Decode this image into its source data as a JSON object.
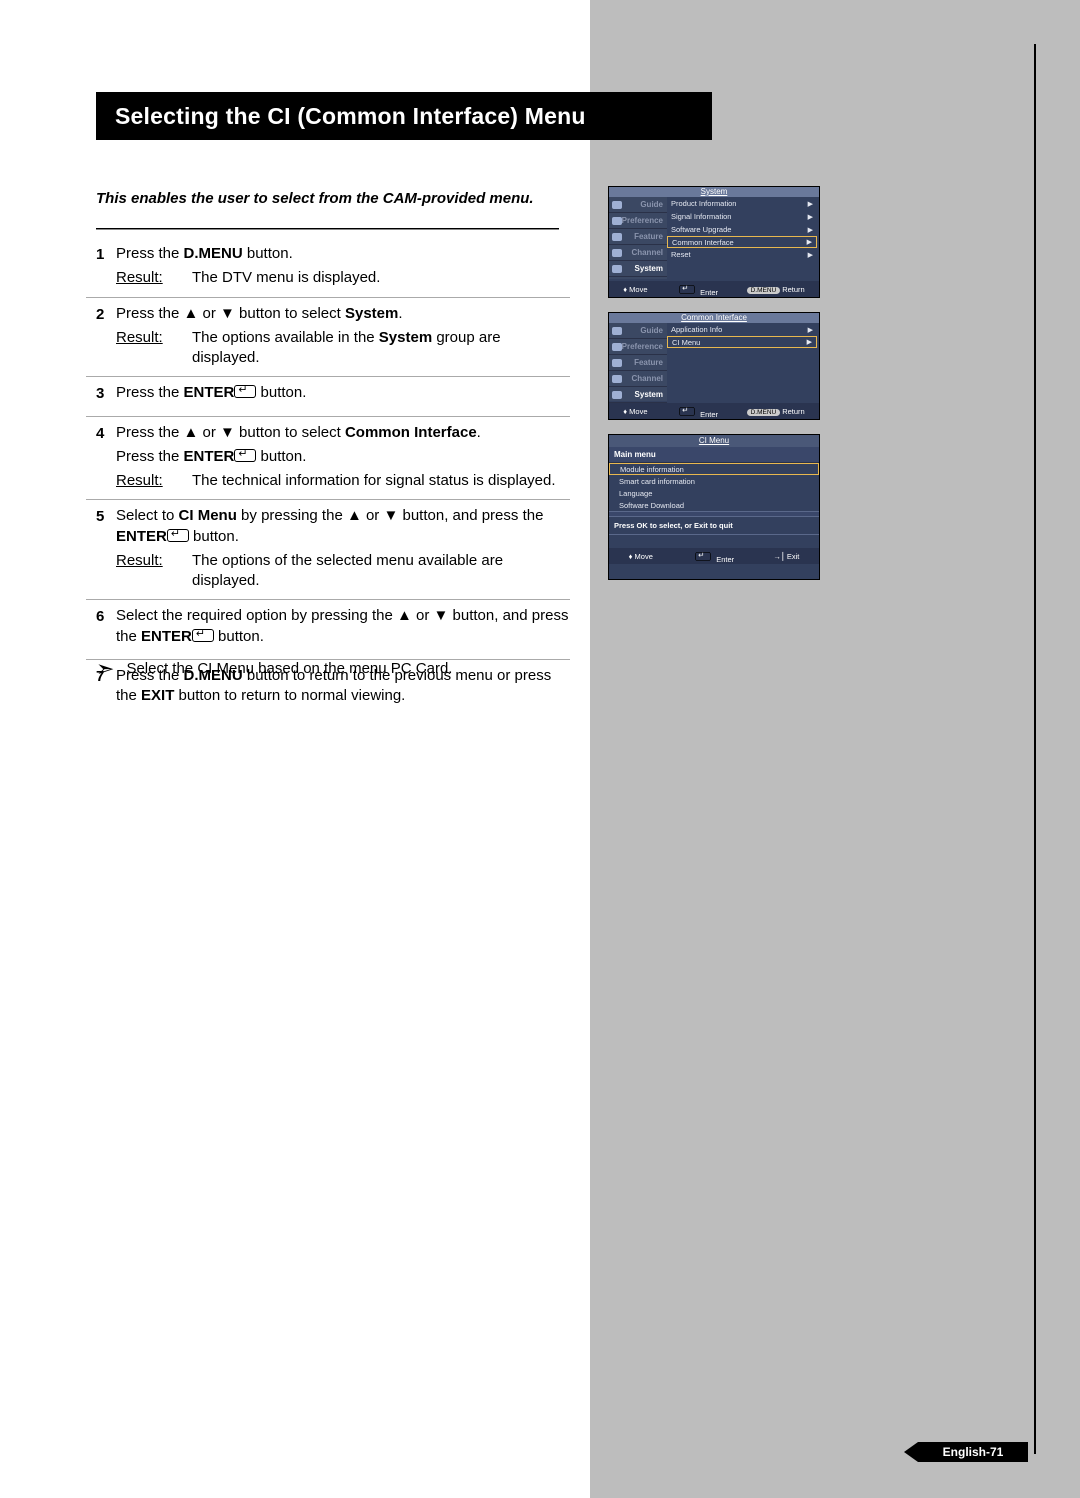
{
  "title": "Selecting the CI (Common Interface) Menu",
  "intro": "This enables the user to select from the CAM-provided menu.",
  "result_label": "Result:",
  "steps": [
    {
      "n": "1",
      "line": [
        "Press the ",
        {
          "b": "D.MENU"
        },
        " button."
      ],
      "result": "The DTV menu is displayed."
    },
    {
      "n": "2",
      "line": [
        "Press the ▲ or ▼ button to select ",
        {
          "b": "System"
        },
        "."
      ],
      "result": [
        "The options available in the ",
        {
          "b": "System"
        },
        " group are displayed."
      ]
    },
    {
      "n": "3",
      "line": [
        "Press the ",
        {
          "b": "ENTER"
        },
        {
          "glyph": true
        },
        "  button."
      ]
    },
    {
      "n": "4",
      "lines": [
        [
          "Press the ▲ or ▼ button to select ",
          {
            "b": "Common Interface"
          },
          "."
        ],
        [
          "Press the ",
          {
            "b": "ENTER"
          },
          {
            "glyph": true
          },
          "  button."
        ]
      ],
      "result": "The technical information for signal status is displayed."
    },
    {
      "n": "5",
      "lines": [
        [
          "Select to ",
          {
            "b": "CI Menu"
          },
          " by pressing the ▲ or ▼ button, and press the ",
          {
            "b": "ENTER"
          },
          {
            "glyph": true
          },
          "  button."
        ]
      ],
      "result": "The options of the selected menu available are displayed."
    },
    {
      "n": "6",
      "lines": [
        [
          "Select the required option by pressing the ▲ or ▼ button, and press the ",
          {
            "b": "ENTER"
          },
          {
            "glyph": true
          },
          "  button."
        ]
      ]
    },
    {
      "n": "7",
      "lines": [
        [
          "Press the ",
          {
            "b": "D.MENU"
          },
          " button to return to the previous menu or press the ",
          {
            "b": "EXIT"
          },
          " button to return to normal viewing."
        ]
      ]
    }
  ],
  "note": "Select the CI Menu based on the menu  PC Card.",
  "osd1": {
    "title": "System",
    "tabs": [
      "Guide",
      "Preference",
      "Feature",
      "Channel",
      "System"
    ],
    "items": [
      "Product Information",
      "Signal Information",
      "Software Upgrade",
      "Common Interface",
      "Reset"
    ],
    "hl": 3,
    "footer": {
      "move": "Move",
      "enter": "Enter",
      "return_pill": "D.MENU",
      "ret": "Return"
    }
  },
  "osd2": {
    "title": "Common Interface",
    "tabs": [
      "Guide",
      "Preference",
      "Feature",
      "Channel",
      "System"
    ],
    "items": [
      "Application Info",
      "CI Menu"
    ],
    "hl": 1,
    "footer": {
      "move": "Move",
      "enter": "Enter",
      "return_pill": "D.MENU",
      "ret": "Return"
    }
  },
  "osd3": {
    "title": "CI Menu",
    "sub": "Main menu",
    "items": [
      "Module information",
      "Smart card information",
      "Language",
      "Software Download"
    ],
    "hl": 0,
    "prompt": "Press OK to select, or Exit to quit",
    "footer": {
      "move": "Move",
      "enter": "Enter",
      "exit": "Exit"
    }
  },
  "page_number": "English-71"
}
